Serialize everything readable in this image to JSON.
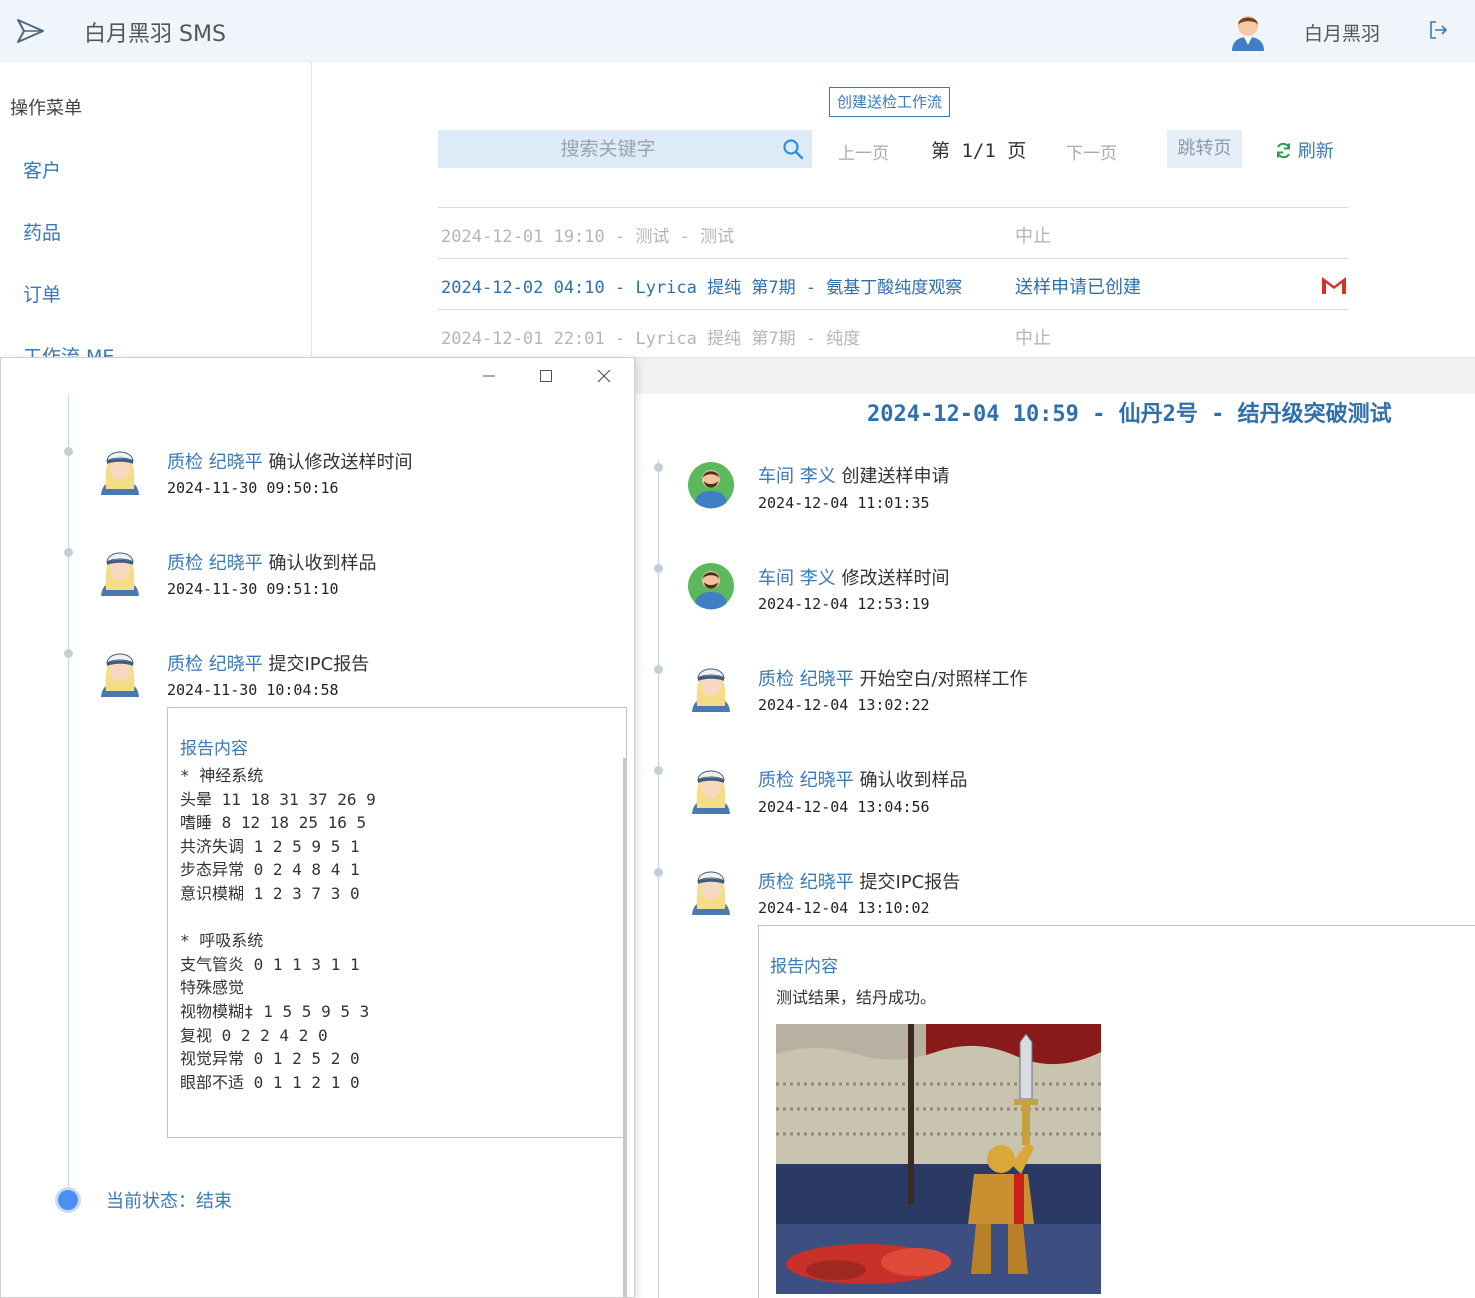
{
  "header": {
    "app_title": "白月黑羽 SMS",
    "user_name": "白月黑羽"
  },
  "sidebar": {
    "title": "操作菜单",
    "items": [
      {
        "label": "客户"
      },
      {
        "label": "药品"
      },
      {
        "label": "订单"
      },
      {
        "label": "工作流 ME"
      }
    ]
  },
  "toolbar": {
    "create_label": "创建送检工作流",
    "search_placeholder": "搜索关键字",
    "prev_label": "上一页",
    "page_indicator": "第 1/1 页",
    "next_label": "下一页",
    "jump_label": "跳转页",
    "refresh_label": "刷新"
  },
  "workflows": [
    {
      "text": "2024-12-01 19:10 - 测试 - 测试",
      "status": "中止",
      "state": "dim",
      "mail": false
    },
    {
      "text": "2024-12-02 04:10 - Lyrica 提纯 第7期 - 氨基丁酸纯度观察",
      "status": "送样申请已创建",
      "state": "active",
      "mail": true
    },
    {
      "text": "2024-12-01 22:01 - Lyrica 提纯 第7期 - 纯度",
      "status": "中止",
      "state": "dim",
      "mail": false
    }
  ],
  "detail": {
    "title": "2024-12-04 10:59 - 仙丹2号 - 结丹级突破测试",
    "events": [
      {
        "role": "车间 李义",
        "action": "创建送样申请",
        "time": "2024-12-04 11:01:35",
        "avatar": "man-avatar-icon"
      },
      {
        "role": "车间 李义",
        "action": "修改送样时间",
        "time": "2024-12-04 12:53:19",
        "avatar": "man-avatar-icon"
      },
      {
        "role": "质检 纪晓平",
        "action": "开始空白/对照样工作",
        "time": "2024-12-04 13:02:22",
        "avatar": "woman-avatar-icon"
      },
      {
        "role": "质检 纪晓平",
        "action": "确认收到样品",
        "time": "2024-12-04 13:04:56",
        "avatar": "woman-avatar-icon"
      },
      {
        "role": "质检 纪晓平",
        "action": "提交IPC报告",
        "time": "2024-12-04 13:10:02",
        "avatar": "woman-avatar-icon"
      }
    ],
    "report_title": "报告内容",
    "report_text": "测试结果，结丹成功。"
  },
  "window": {
    "events": [
      {
        "role": "质检 纪晓平",
        "action": "确认修改送样时间",
        "time": "2024-11-30 09:50:16"
      },
      {
        "role": "质检 纪晓平",
        "action": "确认收到样品",
        "time": "2024-11-30 09:51:10"
      },
      {
        "role": "质检 纪晓平",
        "action": "提交IPC报告",
        "time": "2024-11-30 10:04:58"
      }
    ],
    "report_title": "报告内容",
    "report_lines": [
      "* 神经系统",
      "头晕 11 18 31 37 26 9",
      "嗜睡 8 12 18 25 16 5",
      "共济失调 1 2 5 9 5 1",
      "步态异常 0 2 4 8 4 1",
      "意识模糊 1 2 3 7 3 0",
      "",
      "* 呼吸系统",
      "支气管炎 0 1 1 3 1 1",
      "特殊感觉",
      "视物模糊‡ 1 5 5 9 5 3",
      "复视 0 2 2 4 2 0",
      "视觉异常 0 1 2 5 2 0",
      "眼部不适 0 1 1 2 1 0"
    ],
    "current_status": "当前状态：结束"
  }
}
